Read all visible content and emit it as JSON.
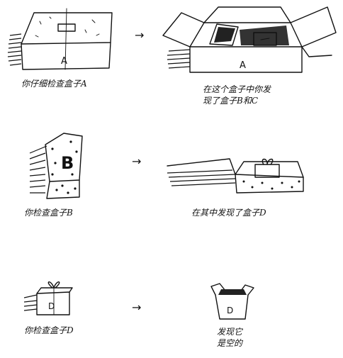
{
  "row1": {
    "left_box_label": "A",
    "left_caption": "你仔细检查盒子A",
    "right_box_label": "A",
    "right_caption_line1": "在这个盒子中你发",
    "right_caption_line2": "现了盒子B和C"
  },
  "row2": {
    "left_box_label": "B",
    "left_caption": "你检查盒子B",
    "right_caption": "在其中发现了盒子D"
  },
  "row3": {
    "left_box_label": "D",
    "left_caption": "你检查盒子D",
    "right_box_label": "D",
    "right_caption_line1": "发现它",
    "right_caption_line2": "是空的"
  },
  "arrow_glyph": "→"
}
